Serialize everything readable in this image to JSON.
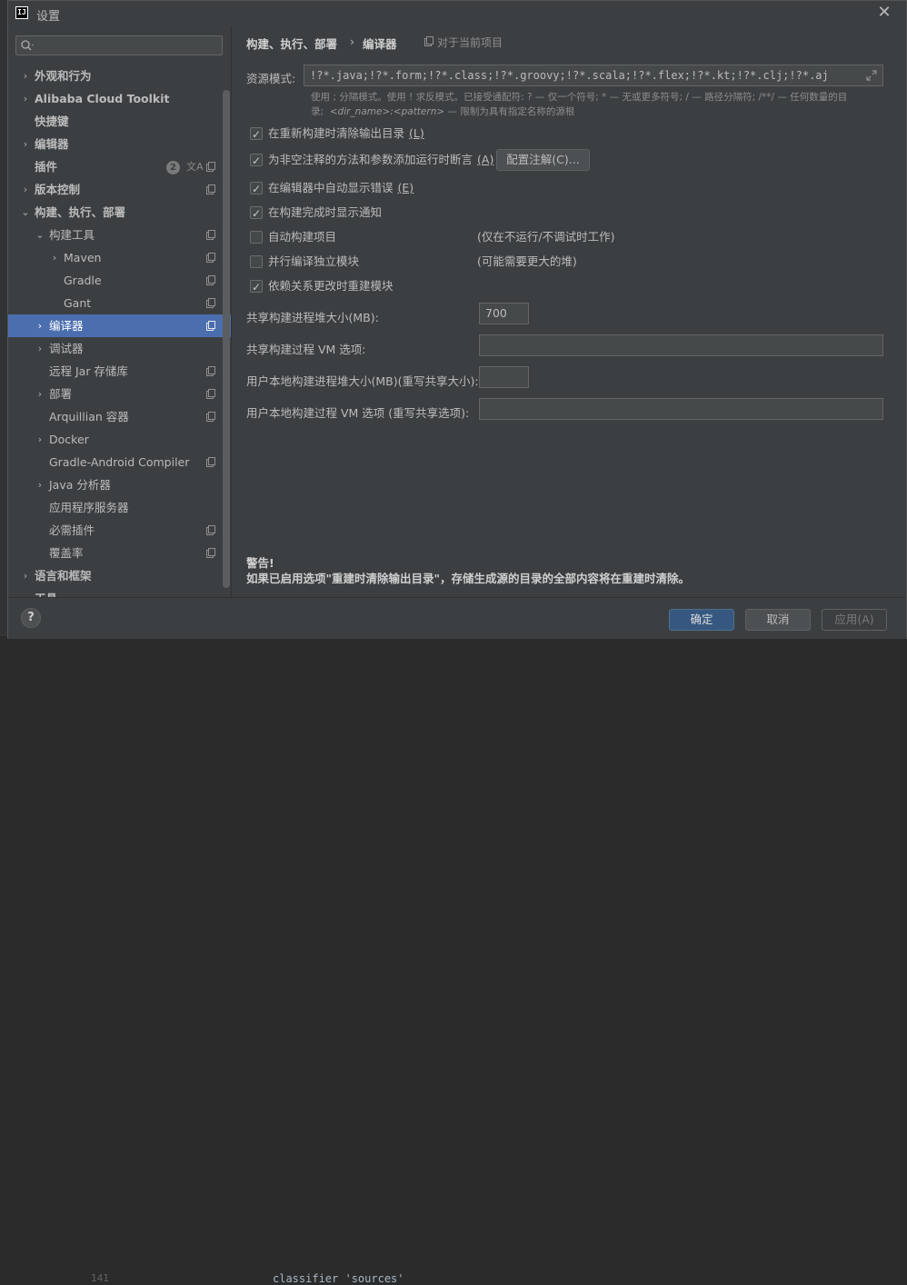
{
  "window": {
    "title": "设置"
  },
  "sidebar": {
    "items": [
      {
        "label": "外观和行为",
        "level": 0,
        "arrow": "›",
        "bold": true,
        "copy": false
      },
      {
        "label": "Alibaba Cloud Toolkit",
        "level": 0,
        "arrow": "›",
        "bold": true,
        "copy": false
      },
      {
        "label": "快捷键",
        "level": 0,
        "arrow": "",
        "bold": true,
        "copy": false
      },
      {
        "label": "编辑器",
        "level": 0,
        "arrow": "›",
        "bold": true,
        "copy": false
      },
      {
        "label": "插件",
        "level": 0,
        "arrow": "",
        "bold": true,
        "copy": true,
        "badge": "2"
      },
      {
        "label": "版本控制",
        "level": 0,
        "arrow": "›",
        "bold": true,
        "copy": true
      },
      {
        "label": "构建、执行、部署",
        "level": 0,
        "arrow": "⌄",
        "bold": true,
        "copy": false
      },
      {
        "label": "构建工具",
        "level": 1,
        "arrow": "⌄",
        "bold": false,
        "copy": true
      },
      {
        "label": "Maven",
        "level": 2,
        "arrow": "›",
        "bold": false,
        "copy": true
      },
      {
        "label": "Gradle",
        "level": 2,
        "arrow": "",
        "bold": false,
        "copy": true
      },
      {
        "label": "Gant",
        "level": 2,
        "arrow": "",
        "bold": false,
        "copy": true
      },
      {
        "label": "编译器",
        "level": 1,
        "arrow": "›",
        "bold": false,
        "copy": true,
        "selected": true
      },
      {
        "label": "调试器",
        "level": 1,
        "arrow": "›",
        "bold": false,
        "copy": false
      },
      {
        "label": "远程 Jar 存储库",
        "level": 1,
        "arrow": "",
        "bold": false,
        "copy": true
      },
      {
        "label": "部署",
        "level": 1,
        "arrow": "›",
        "bold": false,
        "copy": true
      },
      {
        "label": "Arquillian 容器",
        "level": 1,
        "arrow": "",
        "bold": false,
        "copy": true
      },
      {
        "label": "Docker",
        "level": 1,
        "arrow": "›",
        "bold": false,
        "copy": false
      },
      {
        "label": "Gradle-Android Compiler",
        "level": 1,
        "arrow": "",
        "bold": false,
        "copy": true
      },
      {
        "label": "Java 分析器",
        "level": 1,
        "arrow": "›",
        "bold": false,
        "copy": false
      },
      {
        "label": "应用程序服务器",
        "level": 1,
        "arrow": "",
        "bold": false,
        "copy": false
      },
      {
        "label": "必需插件",
        "level": 1,
        "arrow": "",
        "bold": false,
        "copy": true
      },
      {
        "label": "覆盖率",
        "level": 1,
        "arrow": "",
        "bold": false,
        "copy": true
      },
      {
        "label": "语言和框架",
        "level": 0,
        "arrow": "›",
        "bold": true,
        "copy": false
      },
      {
        "label": "工具",
        "level": 0,
        "arrow": "›",
        "bold": true,
        "copy": false
      }
    ]
  },
  "breadcrumb": {
    "parent": "构建、执行、部署",
    "separator": "›",
    "current": "编译器",
    "scope": "对于当前项目"
  },
  "resource": {
    "label": "资源模式:",
    "value": "!?*.java;!?*.form;!?*.class;!?*.groovy;!?*.scala;!?*.flex;!?*.kt;!?*.clj;!?*.aj",
    "hint_line1": "使用 ; 分隔模式。使用 ! 求反模式。已接受通配符: ? — 仅一个符号; * — 无或更多符号; / — 路径分隔符; /**/ — 任何数量的目",
    "hint_line2a": "录;",
    "hint_tpl": "<dir_name>:<pattern>",
    "hint_line2b": "— 限制为具有指定名称的源根"
  },
  "options": [
    {
      "label": "在重新构建时清除输出目录",
      "mnemonic": "(L)",
      "checked": true,
      "note": ""
    },
    {
      "label": "为非空注释的方法和参数添加运行时断言",
      "mnemonic": "(A)",
      "checked": true,
      "note": ""
    },
    {
      "label": "在编辑器中自动显示错误",
      "mnemonic": "(E)",
      "checked": true,
      "note": ""
    },
    {
      "label": "在构建完成时显示通知",
      "mnemonic": "",
      "checked": true,
      "note": ""
    },
    {
      "label": "自动构建项目",
      "mnemonic": "",
      "checked": false,
      "note": "(仅在不运行/不调试时工作)"
    },
    {
      "label": "并行编译独立模块",
      "mnemonic": "",
      "checked": false,
      "note": "(可能需要更大的堆)"
    },
    {
      "label": "依赖关系更改时重建模块",
      "mnemonic": "",
      "checked": true,
      "note": ""
    }
  ],
  "configure_button": "配置注解(C)...",
  "fields": [
    {
      "label": "共享构建进程堆大小(MB):",
      "value": "700"
    },
    {
      "label": "共享构建过程 VM 选项:",
      "value": ""
    },
    {
      "label": "用户本地构建进程堆大小(MB)(重写共享大小):",
      "value": ""
    },
    {
      "label": "用户本地构建过程 VM 选项 (重写共享选项):",
      "value": ""
    }
  ],
  "warning": {
    "title": "警告!",
    "body": "如果已启用选项\"重建时清除输出目录\"，存储生成源的目录的全部内容将在重建时清除。"
  },
  "buttons": {
    "help": "?",
    "ok": "确定",
    "cancel": "取消",
    "apply": "应用(A)"
  },
  "backdrop": {
    "line_number": "141",
    "code": "classifier 'sources'"
  }
}
